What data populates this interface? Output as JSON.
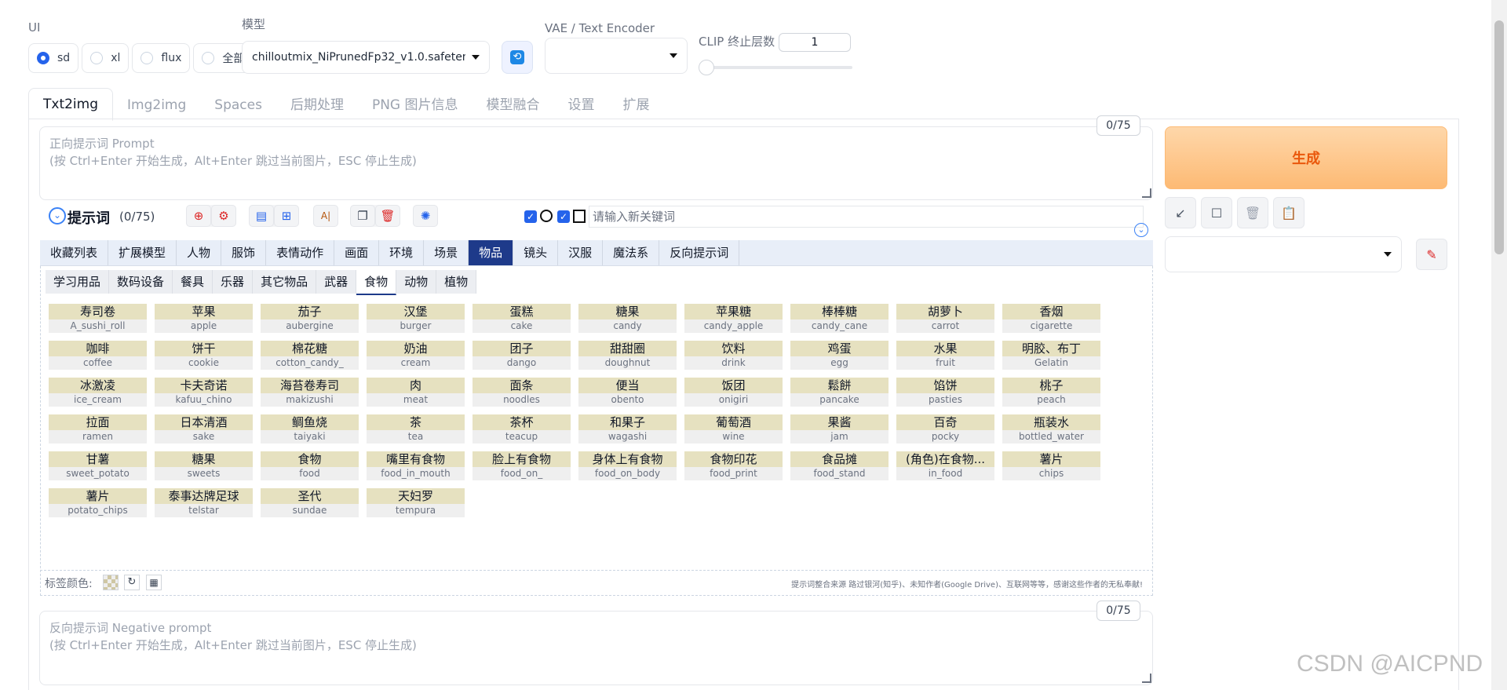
{
  "top": {
    "ui_label": "UI",
    "ui_options": [
      "sd",
      "xl",
      "flux",
      "全部"
    ],
    "ui_selected": "sd",
    "model_label": "模型",
    "model_value": "chilloutmix_NiPrunedFp32_v1.0.safetensors",
    "vae_label": "VAE / Text Encoder",
    "vae_value": "",
    "clip_label": "CLIP 终止层数",
    "clip_value": "1",
    "clip_slider_level": 0
  },
  "tabs": [
    "Txt2img",
    "Img2img",
    "Spaces",
    "后期处理",
    "PNG 图片信息",
    "模型融合",
    "设置",
    "扩展"
  ],
  "active_tab": "Txt2img",
  "prompt": {
    "counter": "0/75",
    "placeholder_line1": "正向提示词 Prompt",
    "placeholder_line2": "(按 Ctrl+Enter 开始生成，Alt+Enter 跳过当前图片，ESC 停止生成)"
  },
  "helper": {
    "title": "提示词",
    "count": "(0/75)",
    "keyword_placeholder": "请输入新关键词",
    "icons": [
      "globe-icon",
      "gear-icon",
      "document-icon",
      "bookmark-icon",
      "ai-translate-icon",
      "copy-icon",
      "trash-icon",
      "openai-icon"
    ]
  },
  "categories": [
    "收藏列表",
    "扩展模型",
    "人物",
    "服饰",
    "表情动作",
    "画面",
    "环境",
    "场景",
    "物品",
    "镜头",
    "汉服",
    "魔法系",
    "反向提示词"
  ],
  "active_category": "物品",
  "subcategories": [
    "学习用品",
    "数码设备",
    "餐具",
    "乐器",
    "其它物品",
    "武器",
    "食物",
    "动物",
    "植物"
  ],
  "active_subcategory": "食物",
  "tags": [
    {
      "cn": "寿司卷",
      "en": "A_sushi_roll"
    },
    {
      "cn": "苹果",
      "en": "apple"
    },
    {
      "cn": "茄子",
      "en": "aubergine"
    },
    {
      "cn": "汉堡",
      "en": "burger"
    },
    {
      "cn": "蛋糕",
      "en": "cake"
    },
    {
      "cn": "糖果",
      "en": "candy"
    },
    {
      "cn": "苹果糖",
      "en": "candy_apple"
    },
    {
      "cn": "棒棒糖",
      "en": "candy_cane"
    },
    {
      "cn": "胡萝卜",
      "en": "carrot"
    },
    {
      "cn": "香烟",
      "en": "cigarette"
    },
    {
      "cn": "咖啡",
      "en": "coffee"
    },
    {
      "cn": "饼干",
      "en": "cookie"
    },
    {
      "cn": "棉花糖",
      "en": "cotton_candy_"
    },
    {
      "cn": "奶油",
      "en": "cream"
    },
    {
      "cn": "团子",
      "en": "dango"
    },
    {
      "cn": "甜甜圈",
      "en": "doughnut"
    },
    {
      "cn": "饮料",
      "en": "drink"
    },
    {
      "cn": "鸡蛋",
      "en": "egg"
    },
    {
      "cn": "水果",
      "en": "fruit"
    },
    {
      "cn": "明胶、布丁",
      "en": "Gelatin"
    },
    {
      "cn": "冰激凌",
      "en": "ice_cream"
    },
    {
      "cn": "卡夫奇诺",
      "en": "kafuu_chino"
    },
    {
      "cn": "海苔卷寿司",
      "en": "makizushi"
    },
    {
      "cn": "肉",
      "en": "meat"
    },
    {
      "cn": "面条",
      "en": "noodles"
    },
    {
      "cn": "便当",
      "en": "obento"
    },
    {
      "cn": "饭团",
      "en": "onigiri"
    },
    {
      "cn": "鬆餅",
      "en": "pancake"
    },
    {
      "cn": "馅饼",
      "en": "pasties"
    },
    {
      "cn": "桃子",
      "en": "peach"
    },
    {
      "cn": "拉面",
      "en": "ramen"
    },
    {
      "cn": "日本清酒",
      "en": "sake"
    },
    {
      "cn": "鲷鱼烧",
      "en": "taiyaki"
    },
    {
      "cn": "茶",
      "en": "tea"
    },
    {
      "cn": "茶杯",
      "en": "teacup"
    },
    {
      "cn": "和果子",
      "en": "wagashi"
    },
    {
      "cn": "葡萄酒",
      "en": "wine"
    },
    {
      "cn": "果酱",
      "en": "jam"
    },
    {
      "cn": "百奇",
      "en": "pocky"
    },
    {
      "cn": "瓶装水",
      "en": "bottled_water"
    },
    {
      "cn": "甘薯",
      "en": "sweet_potato"
    },
    {
      "cn": "糖果",
      "en": "sweets"
    },
    {
      "cn": "食物",
      "en": "food"
    },
    {
      "cn": "嘴里有食物",
      "en": "food_in_mouth"
    },
    {
      "cn": "脸上有食物",
      "en": "food_on_"
    },
    {
      "cn": "身体上有食物",
      "en": "food_on_body"
    },
    {
      "cn": "食物印花",
      "en": "food_print"
    },
    {
      "cn": "食品摊",
      "en": "food_stand"
    },
    {
      "cn": "(角色)在食物...",
      "en": "in_food"
    },
    {
      "cn": "薯片",
      "en": "chips"
    },
    {
      "cn": "薯片",
      "en": "potato_chips"
    },
    {
      "cn": "泰事达牌足球",
      "en": "telstar"
    },
    {
      "cn": "圣代",
      "en": "sundae"
    },
    {
      "cn": "天妇罗",
      "en": "tempura"
    }
  ],
  "footer": {
    "tag_color_label": "标签颜色:",
    "credits": "提示词整合来源 路过银河(知乎)、未知作者(Google Drive)、互联网等等，感谢这些作者的无私奉献!"
  },
  "negative": {
    "counter": "0/75",
    "placeholder_line1": "反向提示词 Negative prompt",
    "placeholder_line2": "(按 Ctrl+Enter 开始生成，Alt+Enter 跳过当前图片，ESC 停止生成)"
  },
  "right": {
    "generate_label": "生成",
    "style_value": ""
  },
  "watermark": "CSDN @AICPND",
  "colors": {
    "accent": "#2563eb",
    "category_active": "#1e3a8a",
    "tag_cn_bg": "#e6e1c0",
    "generate_text": "#ea580c"
  }
}
